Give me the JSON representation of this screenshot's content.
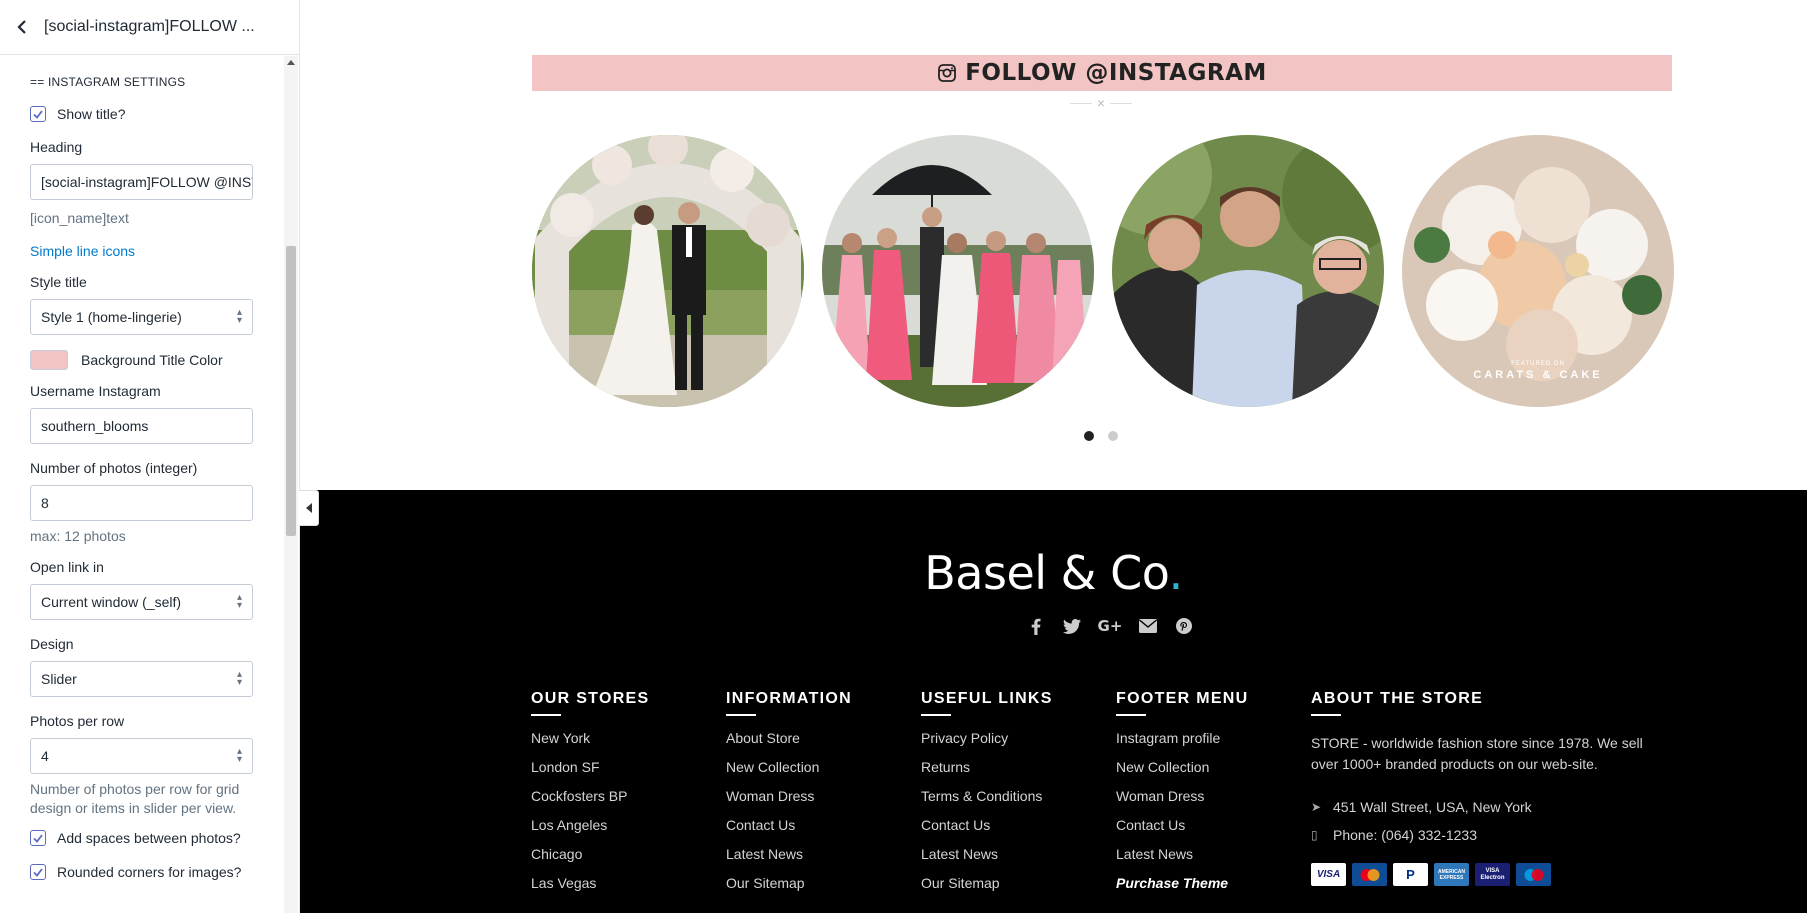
{
  "sidebar": {
    "title": "[social-instagram]FOLLOW ...",
    "section_title": "== INSTAGRAM SETTINGS",
    "show_title_label": "Show title?",
    "show_title_checked": true,
    "heading_label": "Heading",
    "heading_value": "[social-instagram]FOLLOW @INSTAGRAM",
    "heading_help": "[icon_name]text",
    "icons_link": "Simple line icons",
    "style_title_label": "Style title",
    "style_title_value": "Style 1 (home-lingerie)",
    "bg_color_label": "Background Title Color",
    "bg_color": "#f2c4c4",
    "username_label": "Username Instagram",
    "username_value": "southern_blooms",
    "photos_label": "Number of photos (integer)",
    "photos_value": "8",
    "photos_help": "max: 12 photos",
    "open_link_label": "Open link in",
    "open_link_value": "Current window (_self)",
    "design_label": "Design",
    "design_value": "Slider",
    "per_row_label": "Photos per row",
    "per_row_value": "4",
    "per_row_help": "Number of photos per row for grid design or items in slider per view.",
    "spaces_label": "Add spaces between photos?",
    "spaces_checked": true,
    "rounded_label": "Rounded corners for images?",
    "rounded_checked": true
  },
  "preview": {
    "instagram_title": "FOLLOW @INSTAGRAM",
    "title_bg": "#f2c4c4",
    "divider_glyph": "×",
    "photo_overlay_small": "FEATURED ON",
    "photo_overlay_brand": "CARATS & CAKE",
    "slider_dots": 2,
    "active_dot": 0
  },
  "footer": {
    "brand": "Basel & Co",
    "brand_dot": ".",
    "accent": "#2cb6d4",
    "social_icons": [
      "facebook-icon",
      "twitter-icon",
      "google-plus-icon",
      "email-icon",
      "pinterest-icon"
    ],
    "columns": [
      {
        "title": "OUR STORES",
        "items": [
          "New York",
          "London SF",
          "Cockfosters BP",
          "Los Angeles",
          "Chicago",
          "Las Vegas"
        ]
      },
      {
        "title": "INFORMATION",
        "items": [
          "About Store",
          "New Collection",
          "Woman Dress",
          "Contact Us",
          "Latest News",
          "Our Sitemap"
        ]
      },
      {
        "title": "USEFUL LINKS",
        "items": [
          "Privacy Policy",
          "Returns",
          "Terms & Conditions",
          "Contact Us",
          "Latest News",
          "Our Sitemap"
        ]
      },
      {
        "title": "FOOTER MENU",
        "items": [
          "Instagram profile",
          "New Collection",
          "Woman Dress",
          "Contact Us",
          "Latest News",
          "Purchase Theme"
        ]
      }
    ],
    "about": {
      "title": "ABOUT THE STORE",
      "text": "STORE - worldwide fashion store since 1978. We sell over 1000+ branded products on our web-site.",
      "address": "451 Wall Street, USA, New York",
      "phone": "Phone: (064) 332-1233",
      "cards": [
        "VISA",
        "MasterCard",
        "PayPal",
        "AMERICAN EXPRESS",
        "VISA Electron",
        "Maestro"
      ]
    }
  }
}
